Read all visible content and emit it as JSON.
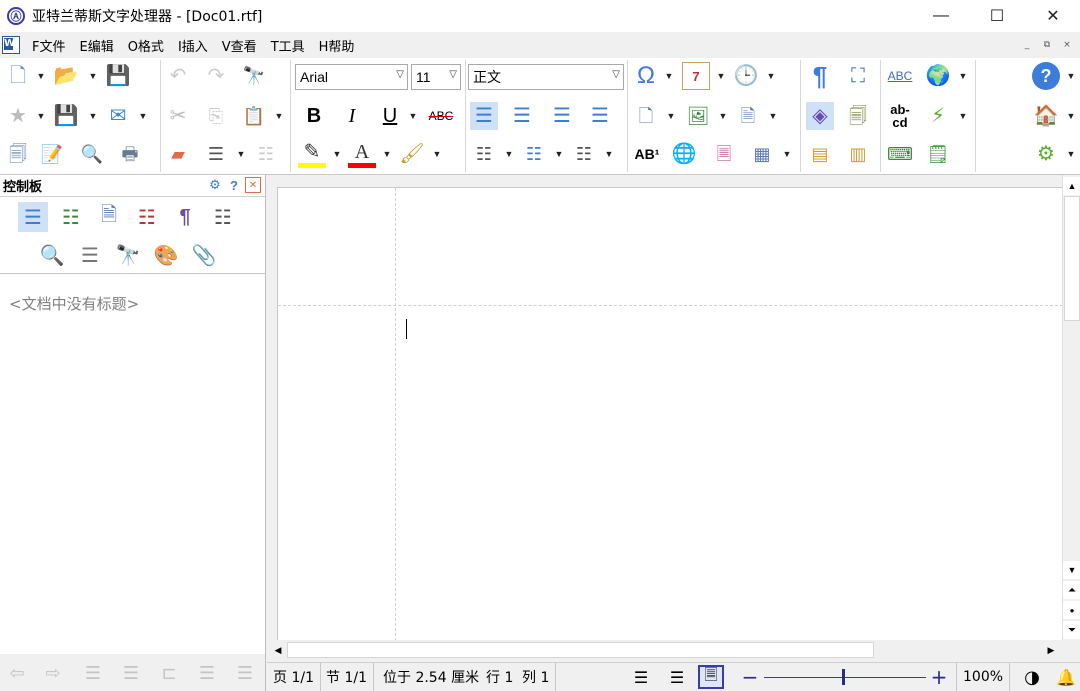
{
  "window": {
    "title": "亚特兰蒂斯文字处理器 - [Doc01.rtf]",
    "logo": "Ⓐ",
    "minimize": "—",
    "maximize": "☐",
    "close": "✕"
  },
  "menu": {
    "items": [
      "F文件",
      "E编辑",
      "O格式",
      "I插入",
      "V查看",
      "T工具",
      "H帮助"
    ],
    "mdi": [
      "_",
      "⧉",
      "×"
    ]
  },
  "toolbar": {
    "font_name": "Arial",
    "font_size": "11",
    "style": "正文",
    "bold": "B",
    "italic": "I",
    "underline": "U",
    "strike": "ABC",
    "symbol": "Ω",
    "date_day": "7",
    "superscript": "AB¹",
    "spell": "ABC",
    "hyphen_top": "ab-",
    "hyphen_bottom": "cd",
    "help": "?",
    "paragraph_mark": "¶"
  },
  "panel": {
    "title": "控制板",
    "empty_message": "<文档中没有标题>",
    "header_icons": [
      "gear-icon",
      "help-icon",
      "close-icon"
    ]
  },
  "status": {
    "page": "页 1/1",
    "section": "节 1/1",
    "position": "位于 2.54 厘米",
    "line": "行 1",
    "column": "列 1",
    "zoom": "100%",
    "zoom_out": "−",
    "zoom_in": "+"
  },
  "colors": {
    "highlight": "#ffff00",
    "font_color": "#ff0000",
    "accent": "#3b7dd8"
  }
}
